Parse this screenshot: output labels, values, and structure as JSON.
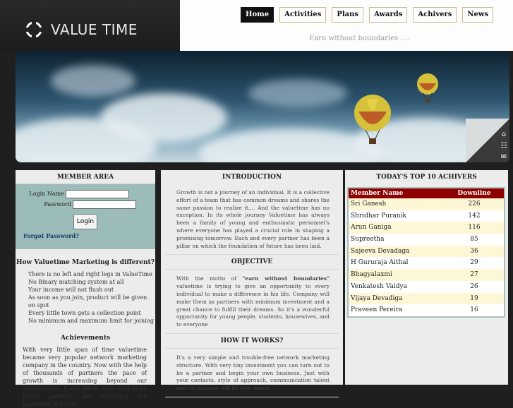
{
  "brand": {
    "name": "VALUE TIME"
  },
  "nav": [
    {
      "label": "Home",
      "active": true
    },
    {
      "label": "Activities"
    },
    {
      "label": "Plans"
    },
    {
      "label": "Awards"
    },
    {
      "label": "Achivers"
    },
    {
      "label": "News"
    }
  ],
  "tagline": "Earn without boundaries ....",
  "side_icons": [
    "home-icon",
    "sitemap-icon",
    "contact-icon"
  ],
  "member": {
    "title": "MEMBER AREA",
    "login_name_label": "Login Name",
    "password_label": "Password",
    "login_button": "Login",
    "forgot": "Forgot Password?",
    "diff_title": "How Valuetime Marketing is different?",
    "diff_items": [
      "There is no left and right legs in ValueTime",
      "No Binary matching system at all",
      "Your income will not flush out",
      "As soon as you join, product will be given on spot",
      "Every little town gets a collection point",
      "No minimum and maximum limit for joining"
    ],
    "ach_title": "Achievements",
    "ach_text": "With very little span of time valuetime became very popular network marketing company in the country. Now with the help of thousands of partners the pace of growth is increasing beyond our expectations. Every week more and more proud partners are receiving the payments; it brings"
  },
  "intro": {
    "title": "INTRODUCTION",
    "intro_text": "Growth is not a journey of an individual. It is a collective effort of a team that has common dreams and shares the same passion to realize it.... And the valuetime has no exception. In its whole journey Valuetime has always been a family of young and enthusiastic personnel's where everyone has played a crucial role in shaping a promising tomorrow. Each and every partner has been a pillar on which the foundation of future has been laid.",
    "objective_title": "OBJECTIVE",
    "objective_before": "With the motto of ",
    "objective_motto": "\"earn without boundaries\"",
    "objective_after": " valuetime is trying to give an opportunity to every individual to make a difference in his life. Company will make them as partners with minimum investment and a great chance to fulfill their dreams. So it's a wonderful opportunity for young people, students, housewives, and to everyone",
    "how_title": "HOW IT WORKS?",
    "how_text": "It's a very simple and trouble-free network marketing structure. With very tiny investment you can turn out to be a partner and begin your own business. Just with your contacts, style of approach, communication talent and enthusiasm will be your assets."
  },
  "top10": {
    "title": "TODAY'S TOP 10 ACHIVERS",
    "col_name": "Member Name",
    "col_val": "Downline",
    "rows": [
      {
        "name": "Sri Ganesh",
        "val": "226"
      },
      {
        "name": "Shridhar Puranik",
        "val": "142"
      },
      {
        "name": "Arun Ganiga",
        "val": "116"
      },
      {
        "name": "Supreetha",
        "val": "85"
      },
      {
        "name": "Sajeeva Devadaga",
        "val": "36"
      },
      {
        "name": "H Gururaja Aithal",
        "val": "29"
      },
      {
        "name": "Bhagyalaxmi",
        "val": "27"
      },
      {
        "name": "Venkatesh Vaidya",
        "val": "26"
      },
      {
        "name": "Vijaya Devadiga",
        "val": "19"
      },
      {
        "name": "Praveen Pereira",
        "val": "16"
      }
    ]
  }
}
